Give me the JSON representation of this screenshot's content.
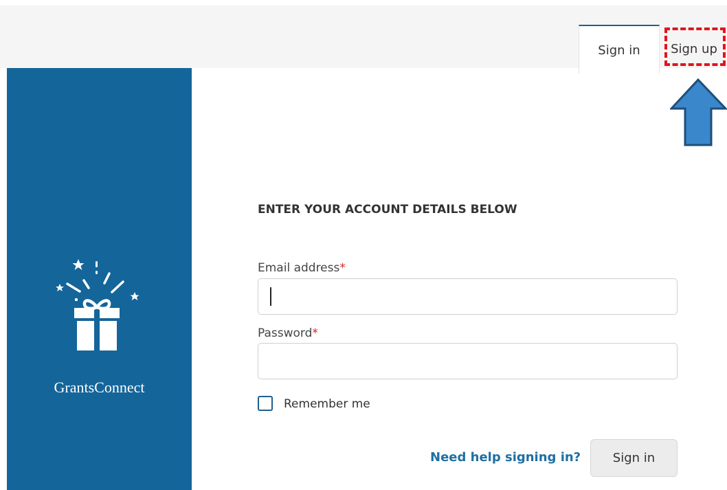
{
  "tabs": {
    "signin_label": "Sign in",
    "signup_label": "Sign up"
  },
  "annotation": {
    "highlight_color": "#e2141d",
    "arrow_color": "#3a87cc"
  },
  "sidebar": {
    "brand_name": "GrantsConnect",
    "logo_icon": "gift-icon",
    "background_color": "#14659a"
  },
  "form": {
    "heading": "ENTER YOUR ACCOUNT DETAILS BELOW",
    "email": {
      "label": "Email address",
      "required_mark": "*",
      "value": ""
    },
    "password": {
      "label": "Password",
      "required_mark": "*",
      "value": ""
    },
    "remember": {
      "label": "Remember me",
      "checked": false
    },
    "help_link": "Need help signing in?",
    "submit_label": "Sign in"
  }
}
